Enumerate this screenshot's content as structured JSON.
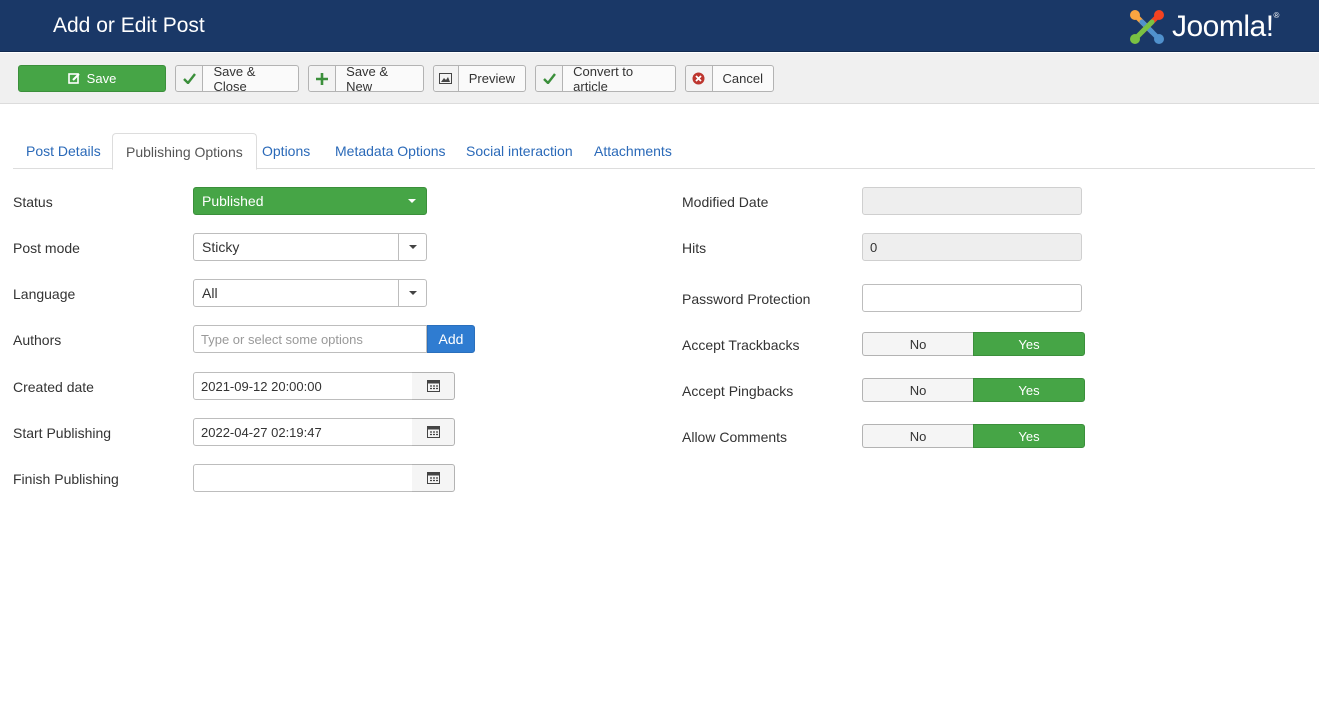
{
  "header": {
    "title": "Add or Edit Post",
    "logo_text": "Joomla!",
    "logo_mark": "®",
    "bg_color": "#1a3867"
  },
  "toolbar": {
    "save": "Save",
    "save_close": "Save & Close",
    "save_new": "Save & New",
    "preview": "Preview",
    "convert": "Convert to article",
    "cancel": "Cancel"
  },
  "tabs": [
    {
      "label": "Post Details"
    },
    {
      "label": "Publishing Options"
    },
    {
      "label": "Options"
    },
    {
      "label": "Metadata Options"
    },
    {
      "label": "Social interaction"
    },
    {
      "label": "Attachments"
    }
  ],
  "left": {
    "status_label": "Status",
    "status_value": "Published",
    "post_mode_label": "Post mode",
    "post_mode_value": "Sticky",
    "language_label": "Language",
    "language_value": "All",
    "authors_label": "Authors",
    "authors_placeholder": "Type or select some options",
    "authors_add": "Add",
    "created_label": "Created date",
    "created_value": "2021-09-12 20:00:00",
    "start_label": "Start Publishing",
    "start_value": "2022-04-27 02:19:47",
    "finish_label": "Finish Publishing",
    "finish_value": ""
  },
  "right": {
    "modified_label": "Modified Date",
    "modified_value": "",
    "hits_label": "Hits",
    "hits_value": "0",
    "password_label": "Password Protection",
    "password_value": "",
    "trackbacks_label": "Accept Trackbacks",
    "pingbacks_label": "Accept Pingbacks",
    "comments_label": "Allow Comments",
    "no": "No",
    "yes": "Yes"
  },
  "colors": {
    "accent_green": "#46a546",
    "link_blue": "#2a69b8",
    "add_blue": "#2f7cd1",
    "cancel_red": "#bd362f"
  }
}
